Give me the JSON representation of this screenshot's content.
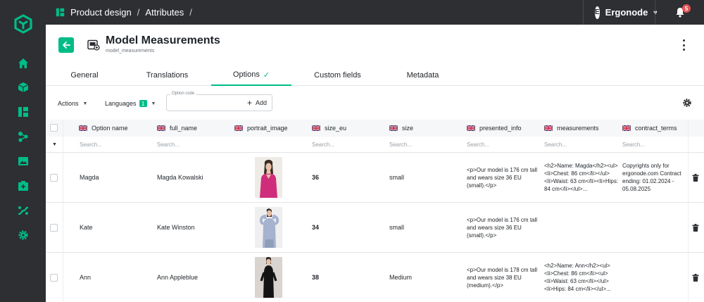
{
  "breadcrumb": {
    "section": "Product design",
    "page": "Attributes",
    "trailing_sep": "/"
  },
  "user": {
    "initial": "E",
    "name": "Ergonode"
  },
  "notifications": {
    "count": "5"
  },
  "attribute": {
    "title": "Model Measurements",
    "code": "model_measurements"
  },
  "tabs": [
    {
      "label": "General"
    },
    {
      "label": "Translations"
    },
    {
      "label": "Options",
      "active": true
    },
    {
      "label": "Custom fields"
    },
    {
      "label": "Metadata"
    }
  ],
  "toolbar": {
    "actions": "Actions",
    "languages": "Languages",
    "languages_count": "1",
    "option_code_label": "Option code",
    "option_code_value": "",
    "add": "Add"
  },
  "columns": [
    {
      "label": "Option name",
      "flag": "gb-flag"
    },
    {
      "label": "full_name",
      "flag": "gb-flag"
    },
    {
      "label": "portrait_image",
      "flag": "gb-flag"
    },
    {
      "label": "size_eu",
      "flag": "gb-flag"
    },
    {
      "label": "size",
      "flag": "gb-flag"
    },
    {
      "label": "presented_info",
      "flag": "gb-flag"
    },
    {
      "label": "measurements",
      "flag": "gb-flag"
    },
    {
      "label": "contract_terms",
      "flag": "gb-flag"
    }
  ],
  "filter_placeholder": "Search...",
  "rows": [
    {
      "option_name": "Magda",
      "full_name": "Magda Kowalski",
      "portrait": "portrait-magda",
      "size_eu": "36",
      "size": "small",
      "presented_info": "<p>Our model is 176 cm tall and wears size 36 EU (small).</p>",
      "measurements": "<h2>Name: Magda</h2><ul><li>Chest: 86 cm</li></ul><li>Waist: 63 cm</li><li>Hips: 84 cm</li></ul>...",
      "contract_terms": "Copyrights only for ergonode.com Contract ending: 01.02.2024 - 05.08.2025"
    },
    {
      "option_name": "Kate",
      "full_name": "Kate Winston",
      "portrait": "portrait-kate",
      "size_eu": "34",
      "size": "small",
      "presented_info": "<p>Our model is 176 cm tall and wears size 36 EU (small).</p>",
      "measurements": "",
      "contract_terms": ""
    },
    {
      "option_name": "Ann",
      "full_name": "Ann Appleblue",
      "portrait": "portrait-ann",
      "size_eu": "38",
      "size": "Medium",
      "presented_info": "<p>Our model is 178 cm tall and wears size 38 EU (medium).</p>",
      "measurements": "<h2>Name: Ann</h2><ul><li>Chest: 86 cm</li><ul><li>Waist: 63 cm</li></ul><li>Hips: 84 cm</li></ul>...",
      "contract_terms": ""
    }
  ],
  "colors": {
    "accent": "#00bc87",
    "rail": "#2d2f33",
    "badge": "#e25555"
  }
}
